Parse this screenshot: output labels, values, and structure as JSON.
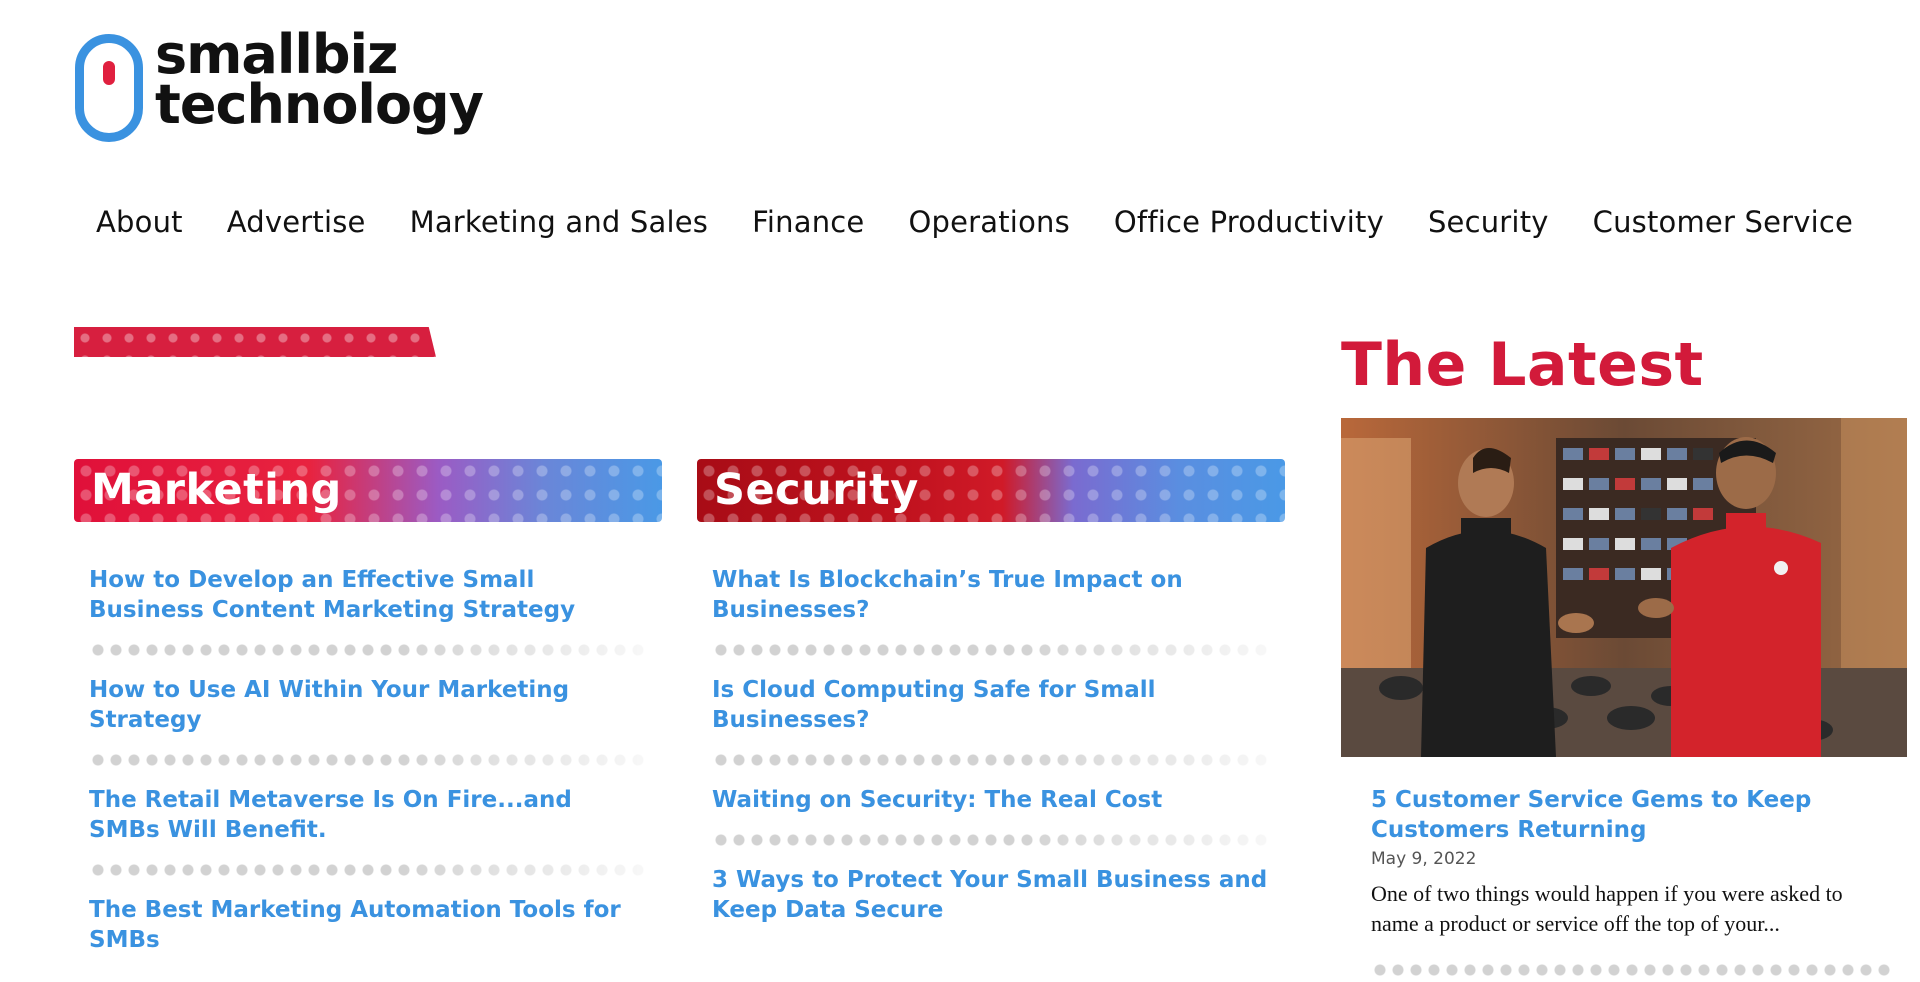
{
  "logo": {
    "line1": "smallbiz",
    "line2": "technology"
  },
  "nav": {
    "items": [
      {
        "label": "About"
      },
      {
        "label": "Advertise"
      },
      {
        "label": "Marketing and Sales"
      },
      {
        "label": "Finance"
      },
      {
        "label": "Operations"
      },
      {
        "label": "Office Productivity"
      },
      {
        "label": "Security"
      },
      {
        "label": "Customer Service"
      }
    ]
  },
  "sections": {
    "marketing": {
      "title": "Marketing",
      "articles": [
        {
          "title": "How to Develop an Effective Small Business Content Marketing Strategy"
        },
        {
          "title": "How to Use AI Within Your Marketing Strategy"
        },
        {
          "title": "The Retail Metaverse Is On Fire...and SMBs Will Benefit."
        },
        {
          "title": "The Best Marketing Automation Tools for SMBs"
        }
      ]
    },
    "security": {
      "title": "Security",
      "articles": [
        {
          "title": "What Is Blockchain’s True Impact on Businesses?"
        },
        {
          "title": "Is Cloud Computing Safe for Small Businesses?"
        },
        {
          "title": "Waiting on Security: The Real Cost"
        },
        {
          "title": "3 Ways to Protect Your Small Business and Keep Data Secure"
        }
      ]
    }
  },
  "latest": {
    "heading": "The Latest",
    "headline": "5 Customer Service Gems to Keep Customers Returning",
    "date": "May 9, 2022",
    "excerpt": "One of two things would happen if you were asked to name a product or service off the top of your..."
  },
  "colors": {
    "accent_blue": "#3a92e0",
    "accent_red": "#d21a3a"
  }
}
